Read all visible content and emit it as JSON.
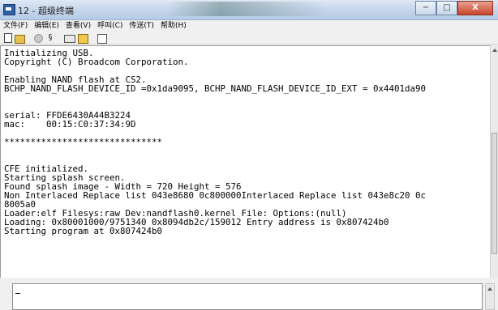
{
  "window": {
    "title": "12 - 超级终端",
    "icon": "terminal-app-icon",
    "buttons": {
      "minimize": "−",
      "maximize": "□",
      "close": "X"
    }
  },
  "menu": {
    "items": [
      {
        "label": "文件(F)"
      },
      {
        "label": "编辑(E)"
      },
      {
        "label": "查看(V)"
      },
      {
        "label": "呼叫(C)"
      },
      {
        "label": "传送(T)"
      },
      {
        "label": "帮助(H)"
      }
    ]
  },
  "toolbar": {
    "icons": [
      "new-document-icon",
      "open-folder-icon",
      "disconnected-icon",
      "properties-icon",
      "call-icon",
      "hang-up-icon",
      "document-properties-icon"
    ],
    "properties_glyph": "§"
  },
  "terminal": {
    "lines": [
      "Initializing USB.",
      "Copyright (C) Broadcom Corporation.",
      "",
      "Enabling NAND flash at CS2.",
      "BCHP_NAND_FLASH_DEVICE_ID =0x1da9095, BCHP_NAND_FLASH_DEVICE_ID_EXT = 0x4401da90",
      "",
      "",
      "serial: FFDE6430A44B3224",
      "mac:    00:15:C0:37:34:9D",
      "",
      "******************************",
      "",
      "",
      "CFE initialized.",
      "Starting splash screen.",
      "Found splash image - Width = 720 Height = 576",
      "Non Interlaced Replace list 043e8680 0c800000Interlaced Replace list 043e8c20 0c",
      "8005a0",
      "Loader:elf Filesys:raw Dev:nandflash0.kernel File: Options:(null)",
      "Loading: 0x80001000/9751340 0x8094db2c/159012 Entry address is 0x807424b0",
      "Starting program at 0x807424b0"
    ]
  },
  "command": {
    "value": ""
  }
}
